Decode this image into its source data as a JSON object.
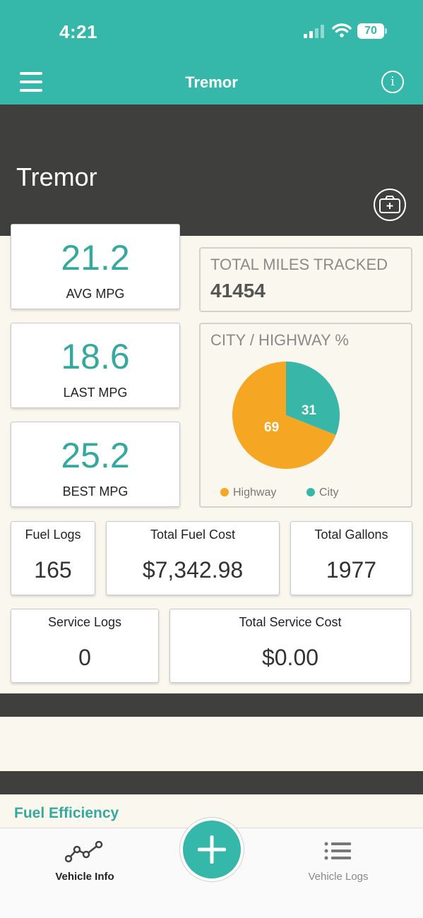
{
  "status_bar": {
    "time": "4:21",
    "battery": "70"
  },
  "nav": {
    "title": "Tremor"
  },
  "vehicle": {
    "name": "Tremor"
  },
  "mpg": {
    "avg": {
      "value": "21.2",
      "label": "AVG MPG"
    },
    "last": {
      "value": "18.6",
      "label": "LAST MPG"
    },
    "best": {
      "value": "25.2",
      "label": "BEST MPG"
    }
  },
  "total_miles": {
    "label": "TOTAL MILES TRACKED",
    "value": "41454"
  },
  "city_highway": {
    "title": "CITY / HIGHWAY %",
    "highway_label": "Highway",
    "city_label": "City"
  },
  "chart_data": {
    "type": "pie",
    "title": "CITY / HIGHWAY %",
    "series": [
      {
        "name": "Highway",
        "value": 69,
        "color": "#f5a623"
      },
      {
        "name": "City",
        "value": 31,
        "color": "#38b6a8"
      }
    ],
    "legend": "bottom"
  },
  "stats": {
    "fuel_logs": {
      "label": "Fuel Logs",
      "value": "165"
    },
    "total_fuel_cost": {
      "label": "Total Fuel Cost",
      "value": "$7,342.98"
    },
    "total_gallons": {
      "label": "Total Gallons",
      "value": "1977"
    },
    "service_logs": {
      "label": "Service Logs",
      "value": "0"
    },
    "total_service_cost": {
      "label": "Total Service Cost",
      "value": "$0.00"
    }
  },
  "sections": {
    "fuel_efficiency": "Fuel Efficiency"
  },
  "tabbar": {
    "vehicle_info": "Vehicle Info",
    "vehicle_logs": "Vehicle Logs"
  },
  "colors": {
    "accent": "#35b8aa",
    "highway": "#f5a623",
    "city": "#38b6a8",
    "dark_band": "#3f3f3d",
    "background": "#faf8ee"
  }
}
